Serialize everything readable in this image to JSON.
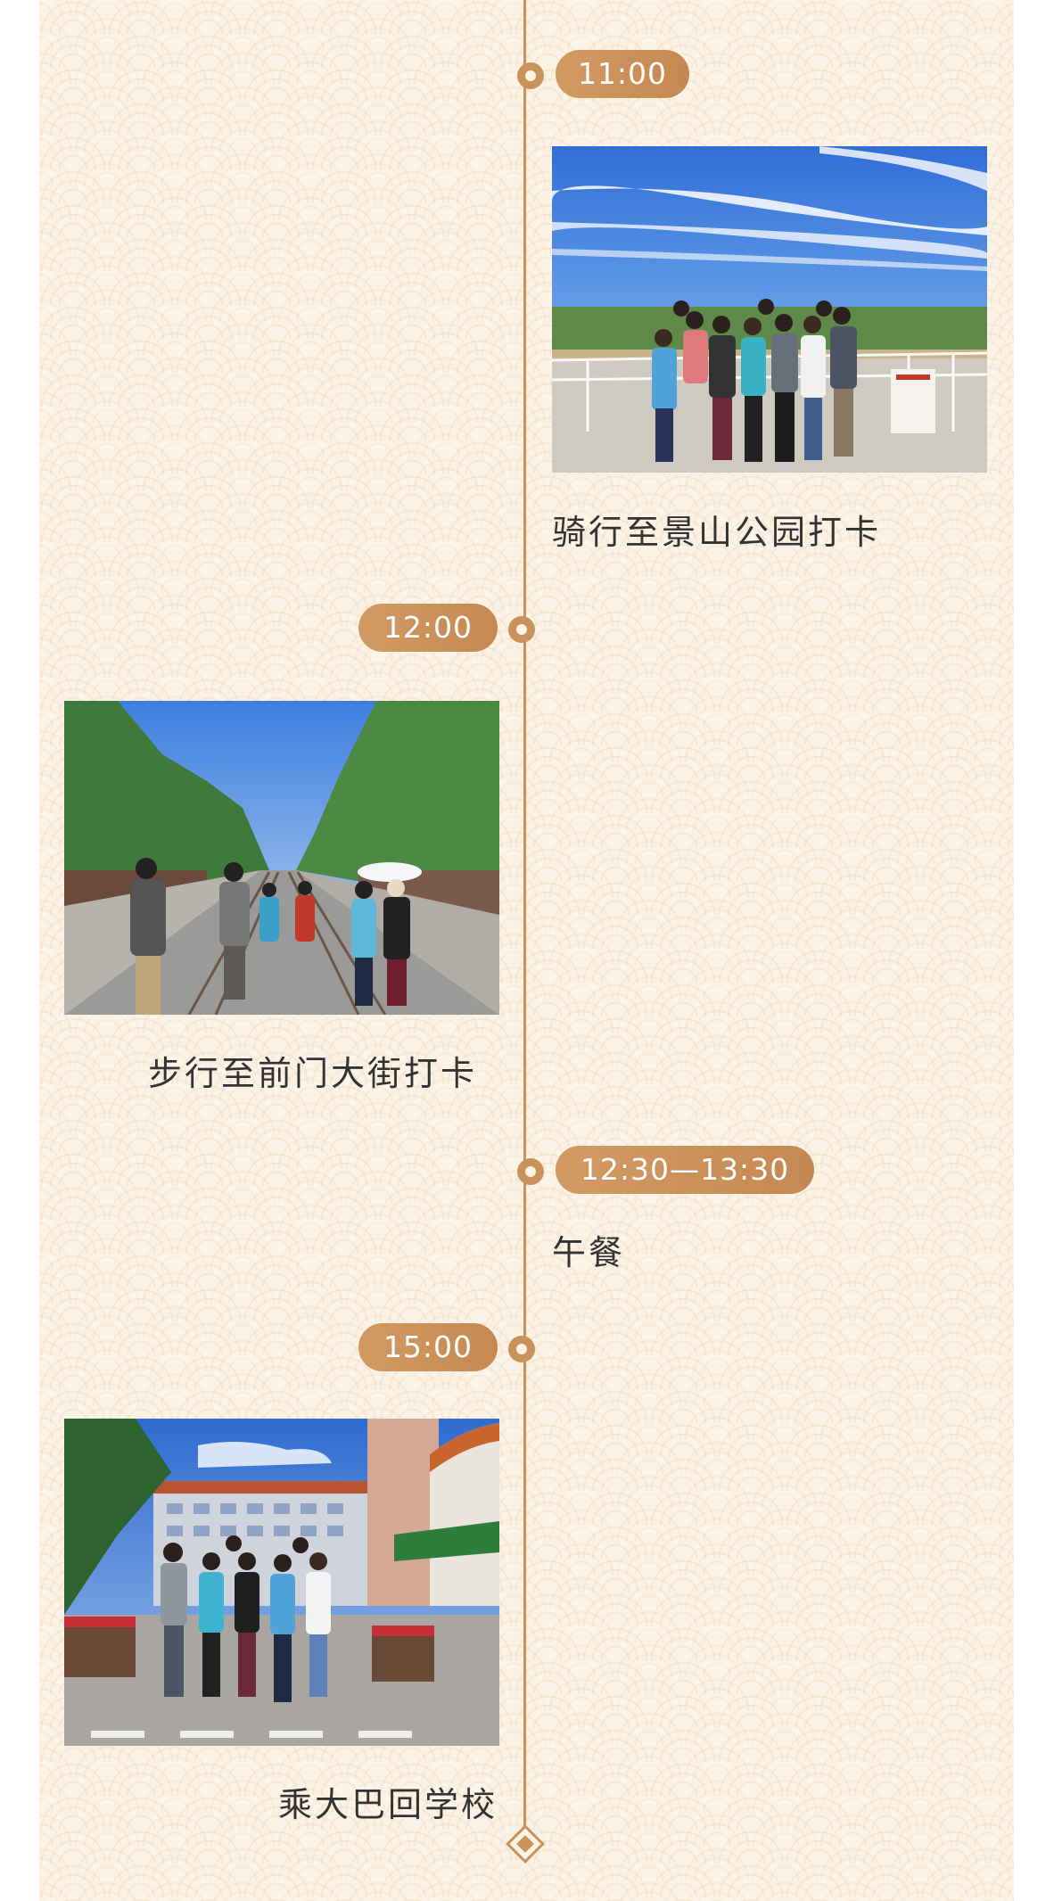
{
  "timeline": {
    "events": [
      {
        "time": "11:00",
        "caption": "骑行至景山公园打卡",
        "photo": "group-photo-at-jingshan-park"
      },
      {
        "time": "12:00",
        "caption": "步行至前门大街打卡",
        "photo": "qianmen-street-photo"
      },
      {
        "time": "12:30—13:30",
        "caption": "午餐"
      },
      {
        "time": "15:00",
        "caption": "乘大巴回学校",
        "photo": "group-photo-at-school"
      }
    ],
    "end_marker": "diamond-icon"
  },
  "colors": {
    "accent": "#c9925a",
    "background": "#fcf3e6",
    "text": "#333333"
  }
}
